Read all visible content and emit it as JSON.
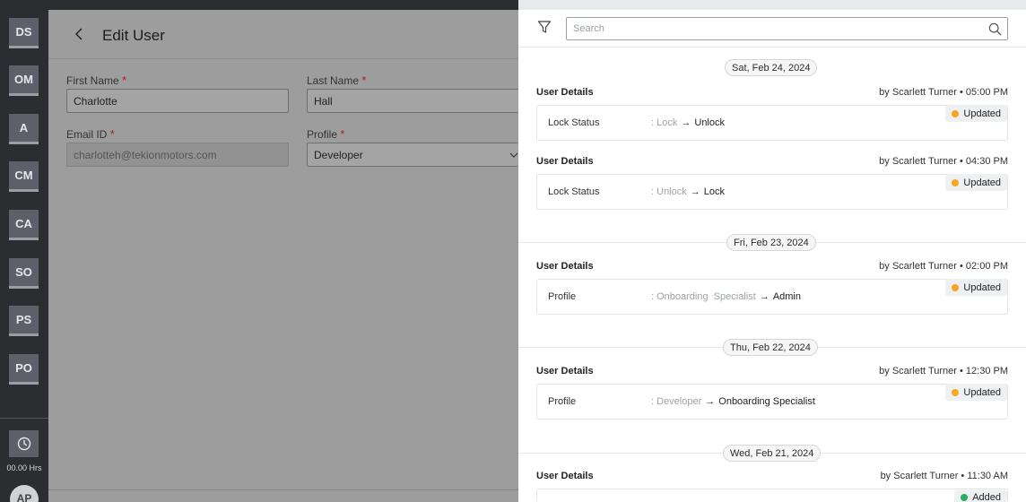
{
  "rail": {
    "items": [
      "DS",
      "OM",
      "A",
      "CM",
      "CA",
      "SO",
      "PS",
      "PO"
    ],
    "time": "00.00 Hrs",
    "avatar": "AP"
  },
  "edit_user": {
    "title": "Edit User",
    "first_name_label": "First Name",
    "first_name_value": "Charlotte",
    "last_name_label": "Last Name",
    "last_name_value": "Hall",
    "email_label": "Email ID",
    "email_value": "charlotteh@tekionmotors.com",
    "profile_label": "Profile",
    "profile_value": "Developer",
    "required_mark": "*"
  },
  "drawer": {
    "search_placeholder": "Search",
    "groups": [
      {
        "date": "Sat, Feb 24, 2024",
        "entries": [
          {
            "title": "User Details",
            "by": "by Scarlett Turner • 05:00 PM",
            "field": "Lock Status",
            "old": "Lock",
            "new": "Unlock",
            "status": "Updated"
          },
          {
            "title": "User Details",
            "by": "by Scarlett Turner • 04:30 PM",
            "field": "Lock Status",
            "old": "Unlock",
            "new": "Lock",
            "status": "Updated"
          }
        ]
      },
      {
        "date": "Fri, Feb 23, 2024",
        "entries": [
          {
            "title": "User Details",
            "by": "by Scarlett Turner • 02:00 PM",
            "field": "Profile",
            "old": "Onboarding  Specialist",
            "new": "Admin",
            "status": "Updated"
          }
        ]
      },
      {
        "date": "Thu, Feb 22, 2024",
        "entries": [
          {
            "title": "User Details",
            "by": "by Scarlett Turner • 12:30 PM",
            "field": "Profile",
            "old": "Developer",
            "new": "Onboarding Specialist",
            "status": "Updated"
          }
        ]
      },
      {
        "date": "Wed, Feb 21, 2024",
        "entries": [
          {
            "title": "User Details",
            "by": "by Scarlett Turner • 11:30 AM",
            "status": "Added"
          }
        ]
      }
    ],
    "colors": {
      "updated": "#f5a623",
      "added": "#27ae60"
    }
  }
}
